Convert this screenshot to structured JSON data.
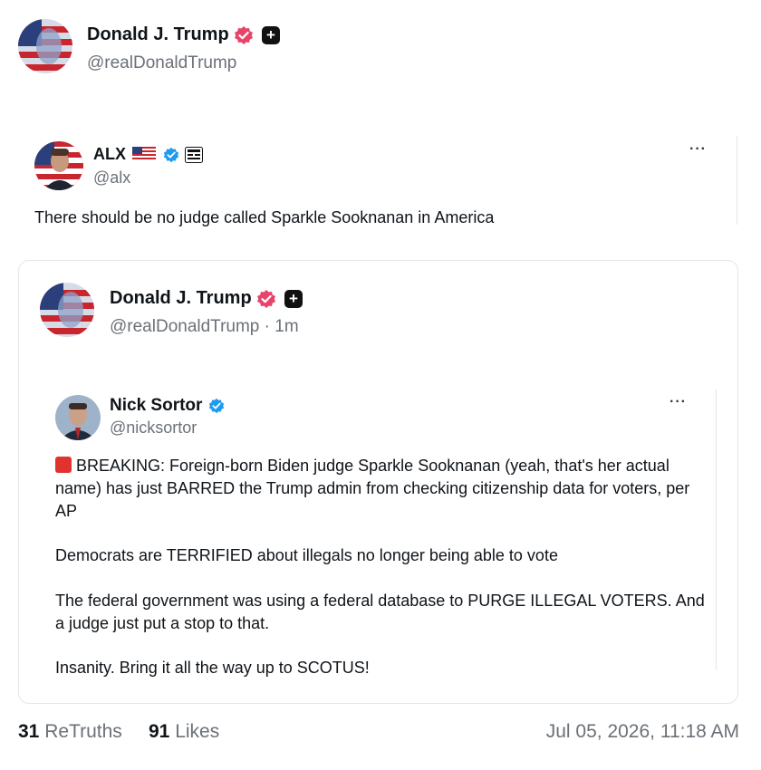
{
  "post": {
    "author_name": "Donald J. Trump",
    "author_handle": "@realDonaldTrump",
    "verified_icon": "pink-verified-badge-icon",
    "plus_icon": "plus-box-icon"
  },
  "alx_post": {
    "author_name": "ALX",
    "author_handle": "@alx",
    "flag": "🇺🇸",
    "more_label": "···",
    "text": "There should be no judge called Sparkle Sooknanan in America"
  },
  "quoted": {
    "author_name": "Donald J. Trump",
    "author_handle": "@realDonaldTrump · 1m"
  },
  "nested": {
    "author_name": "Nick Sortor",
    "author_handle": "@nicksortor",
    "more_label": "···",
    "alert_emoji": "🚨",
    "para1": " BREAKING: Foreign-born Biden judge Sparkle Sooknanan (yeah, that's her actual name) has just BARRED the Trump admin from checking citizenship data for voters, per AP",
    "para2": "Democrats are TERRIFIED about illegals no longer being able to vote",
    "para3": "The federal government was using a federal database to PURGE ILLEGAL VOTERS. And a judge just put a stop to that.",
    "para4": "Insanity. Bring it all the way up to SCOTUS!"
  },
  "footer": {
    "retruths_count": "31",
    "retruths_label": "ReTruths",
    "likes_count": "91",
    "likes_label": "Likes",
    "timestamp": "Jul 05, 2026, 11:18 AM"
  },
  "colors": {
    "verified_pink": "#e8446a",
    "verified_blue": "#1d9bf0",
    "muted_text": "#6b7178"
  }
}
